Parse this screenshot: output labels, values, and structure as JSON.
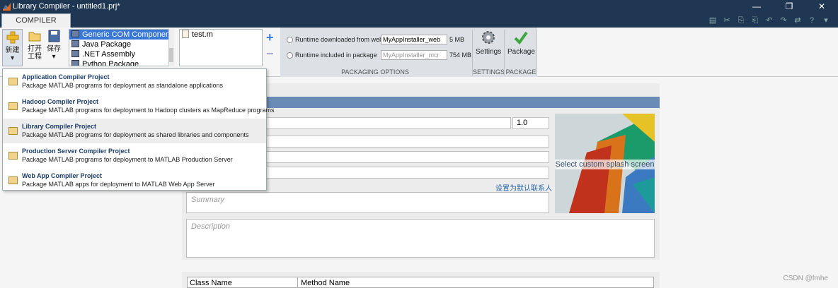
{
  "window": {
    "title": "Library Compiler - untitled1.prj*",
    "minimize": "—",
    "restore": "❐",
    "close": "✕"
  },
  "tabs": {
    "compiler": "COMPILER"
  },
  "quick_access": [
    "▤",
    "✂",
    "⎘",
    "⎗",
    "↶",
    "↷",
    "⇄",
    "?",
    "▾"
  ],
  "toolbar": {
    "new_label": "新建",
    "open_label": "打开\n工程",
    "save_label": "保存"
  },
  "app_types": [
    "Generic COM Component",
    "Java Package",
    ".NET Assembly",
    "Python Package"
  ],
  "files": [
    "test.m"
  ],
  "packaging": {
    "runtime_web_label": "Runtime downloaded from web",
    "runtime_web_value": "MyAppInstaller_web",
    "runtime_web_size": "5 MB",
    "runtime_included_label": "Runtime included in package",
    "runtime_included_value": "MyAppInstaller_mcr",
    "runtime_included_size": "754 MB",
    "group_label": "PACKAGING OPTIONS"
  },
  "settings": {
    "label": "Settings",
    "group": "SETTINGS"
  },
  "package": {
    "label": "Package",
    "group": "PACKAGE"
  },
  "menu": [
    {
      "title": "Application Compiler Project",
      "desc": "Package MATLAB programs for deployment as standalone applications"
    },
    {
      "title": "Hadoop Compiler Project",
      "desc": "Package MATLAB programs for deployment to Hadoop clusters as MapReduce programs"
    },
    {
      "title": "Library Compiler Project",
      "desc": "Package MATLAB programs for deployment as shared libraries and components"
    },
    {
      "title": "Production Server Compiler Project",
      "desc": "Package MATLAB programs for deployment to MATLAB Production Server"
    },
    {
      "title": "Web App Compiler Project",
      "desc": "Package MATLAB apps for deployment to MATLAB Web App Server"
    }
  ],
  "form": {
    "version": "1.0",
    "splash": "Select custom splash screen",
    "set_default": "设置为默认联系人",
    "summary_placeholder": "Summary",
    "description_placeholder": "Description"
  },
  "class_table": {
    "class_col": "Class Name",
    "method_col": "Method Name"
  },
  "watermark": "CSDN @fmhe"
}
